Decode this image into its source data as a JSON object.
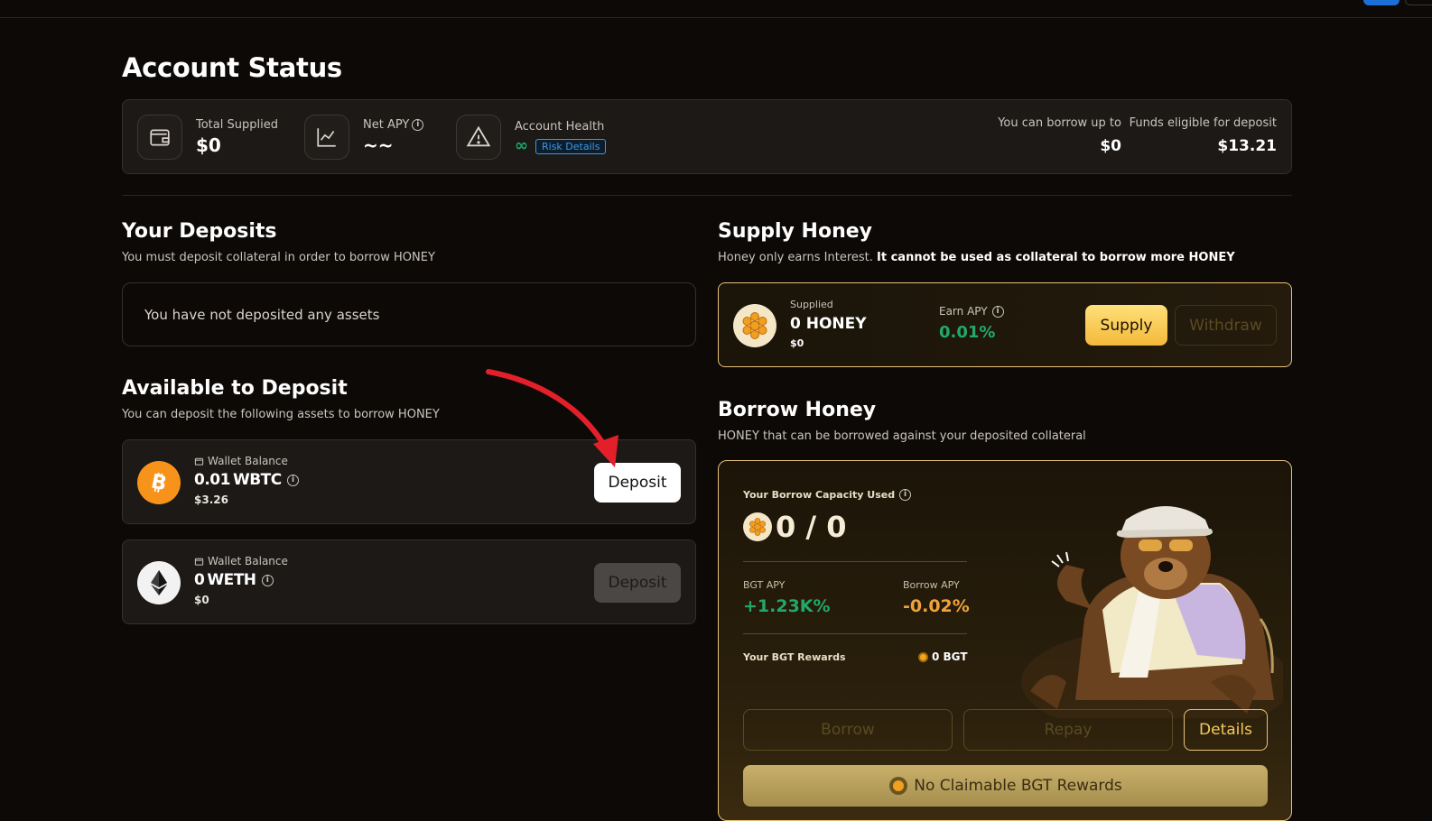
{
  "page_title": "Account Status",
  "status": {
    "total_supplied_label": "Total Supplied",
    "total_supplied_value": "$0",
    "net_apy_label": "Net APY",
    "net_apy_value": "~~",
    "account_health_label": "Account Health",
    "account_health_value": "∞",
    "risk_details_label": "Risk Details",
    "borrow_up_to_label": "You can borrow up to",
    "borrow_up_to_value": "$0",
    "funds_eligible_label": "Funds eligible for deposit",
    "funds_eligible_value": "$13.21"
  },
  "deposits": {
    "title": "Your Deposits",
    "subtitle": "You must deposit collateral in order to borrow HONEY",
    "empty_text": "You have not deposited any assets"
  },
  "available": {
    "title": "Available to Deposit",
    "subtitle": "You can deposit the following assets to borrow HONEY",
    "assets": [
      {
        "wallet_label": "Wallet Balance",
        "amount": "0.01",
        "symbol": "WBTC",
        "usd": "$3.26",
        "button": "Deposit",
        "enabled": true
      },
      {
        "wallet_label": "Wallet Balance",
        "amount": "0",
        "symbol": "WETH",
        "usd": "$0",
        "button": "Deposit",
        "enabled": false
      }
    ]
  },
  "supply": {
    "title": "Supply Honey",
    "subtitle_plain": "Honey only earns Interest. ",
    "subtitle_bold": "It cannot be used as collateral to borrow more HONEY",
    "supplied_label": "Supplied",
    "supplied_amount": "0 HONEY",
    "supplied_usd": "$0",
    "earn_apy_label": "Earn APY",
    "earn_apy_value": "0.01%",
    "supply_button": "Supply",
    "withdraw_button": "Withdraw"
  },
  "borrow": {
    "title": "Borrow Honey",
    "subtitle": "HONEY that can be borrowed against your deposited collateral",
    "capacity_label": "Your Borrow Capacity Used",
    "capacity_value": "0 / 0",
    "bgt_apy_label": "BGT APY",
    "bgt_apy_value": "+1.23K%",
    "borrow_apy_label": "Borrow APY",
    "borrow_apy_value": "-0.02%",
    "bgt_rewards_label": "Your BGT Rewards",
    "bgt_rewards_value": "0 BGT",
    "borrow_button": "Borrow",
    "repay_button": "Repay",
    "details_button": "Details",
    "claim_label": "No Claimable BGT Rewards"
  },
  "colors": {
    "background": "#0d0906",
    "card": "#1c1917",
    "gold_border": "#e8c27a",
    "green": "#22a86b",
    "orange": "#f0a23a",
    "btc": "#f7931a",
    "arrow": "#e3202a"
  }
}
